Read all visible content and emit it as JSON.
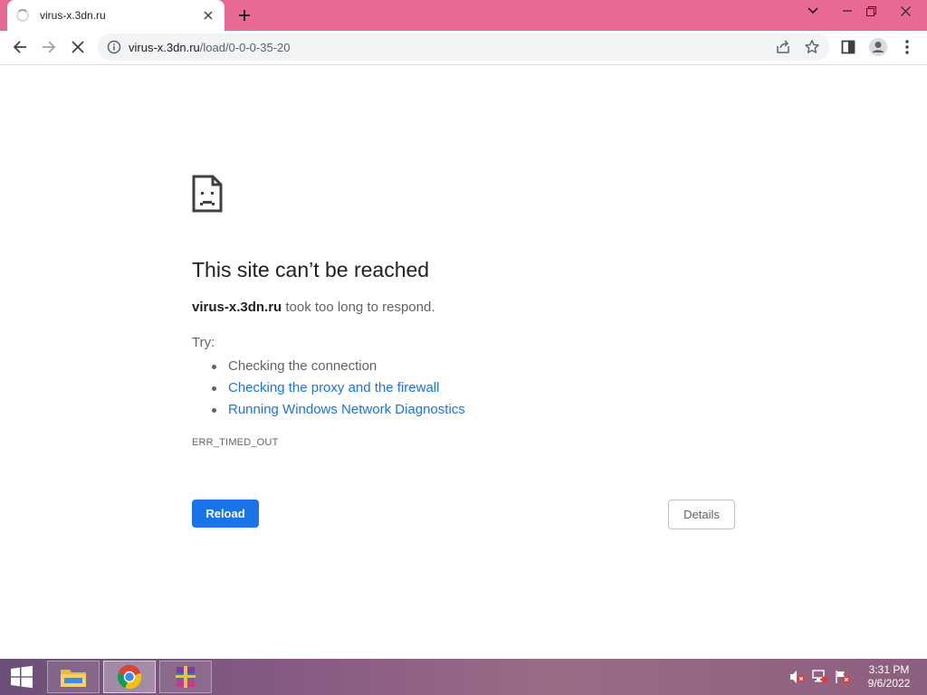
{
  "browser": {
    "tab": {
      "title": "virus-x.3dn.ru"
    },
    "address": {
      "host": "virus-x.3dn.ru",
      "path": "/load/0-0-0-35-20"
    }
  },
  "error_page": {
    "title": "This site can’t be reached",
    "host": "virus-x.3dn.ru",
    "message": " took too long to respond.",
    "try_label": "Try:",
    "suggestions": [
      {
        "text": "Checking the connection",
        "link": false
      },
      {
        "text": "Checking the proxy and the firewall",
        "link": true
      },
      {
        "text": "Running Windows Network Diagnostics",
        "link": true
      }
    ],
    "error_code": "ERR_TIMED_OUT",
    "reload_label": "Reload",
    "details_label": "Details"
  },
  "taskbar": {
    "apps": [
      "file-explorer-icon",
      "chrome-icon",
      "winrar-icon"
    ],
    "tray": [
      "volume-muted-icon",
      "network-icon",
      "action-center-flag-icon"
    ],
    "time": "3:31 PM",
    "date": "9/6/2022"
  },
  "colors": {
    "tabstrip": "#e86992",
    "accent_blue": "#1a73e8",
    "text_primary": "#202124",
    "text_secondary": "#5f6368"
  }
}
